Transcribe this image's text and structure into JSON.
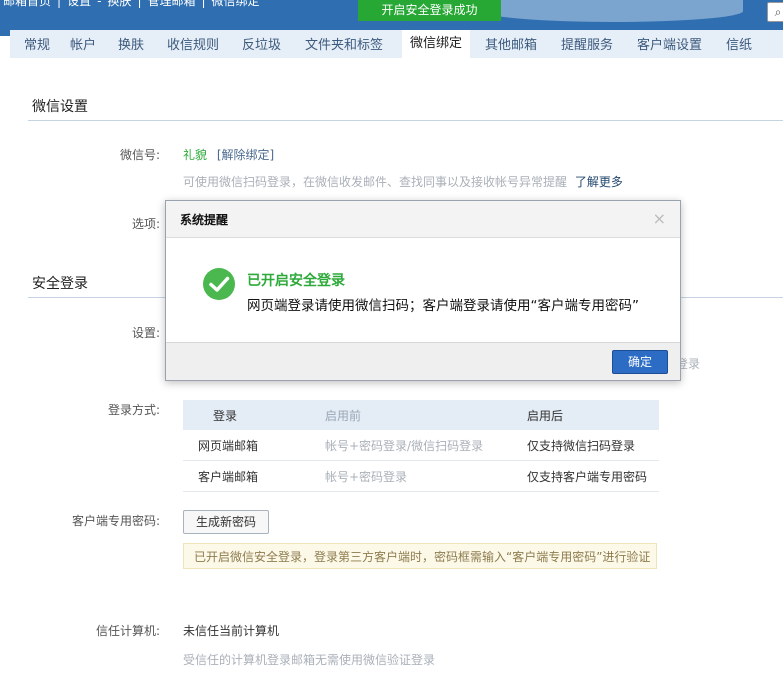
{
  "header": {
    "links": [
      "邮箱首页",
      "|",
      "设置",
      "-",
      "换肤",
      "|",
      "管理邮箱",
      "|",
      "微信绑定"
    ],
    "toast": "开启安全登录成功",
    "search_icon": "search-icon"
  },
  "tabs": [
    {
      "label": "常规"
    },
    {
      "label": "帐户"
    },
    {
      "label": "换肤"
    },
    {
      "label": "收信规则"
    },
    {
      "label": "反垃圾"
    },
    {
      "label": "文件夹和标签"
    },
    {
      "label": "微信绑定",
      "active": true
    },
    {
      "label": "其他邮箱"
    },
    {
      "label": "提醒服务"
    },
    {
      "label": "客户端设置"
    },
    {
      "label": "信纸"
    }
  ],
  "wechat": {
    "section_title": "微信设置",
    "account_label": "微信号:",
    "account_value": "礼貌",
    "unbind_link": "[解除绑定]",
    "hint": "可使用微信扫码登录，在微信收发邮件、查找同事以及接收帐号异常提醒",
    "learn_more": "了解更多",
    "options_label": "选项:"
  },
  "security": {
    "section_title": "安全登录",
    "settings_label": "设置:",
    "settings_suffix": "登录",
    "login_method_label": "登录方式:",
    "table": {
      "headers": [
        "登录",
        "启用前",
        "启用后"
      ],
      "rows": [
        [
          "网页端邮箱",
          "帐号+密码登录/微信扫码登录",
          "仅支持微信扫码登录"
        ],
        [
          "客户端邮箱",
          "帐号+密码登录",
          "仅支持客户端专用密码"
        ]
      ]
    },
    "client_pwd_label": "客户端专用密码:",
    "generate_button": "生成新密码",
    "notice": "已开启微信安全登录，登录第三方客户端时，密码框需输入“客户端专用密码”进行验证",
    "trusted_label": "信任计算机:",
    "trusted_value": "未信任当前计算机",
    "trusted_hint": "受信任的计算机登录邮箱无需使用微信验证登录"
  },
  "modal": {
    "title": "系统提醒",
    "close": "×",
    "message_title": "已开启安全登录",
    "message_body": "网页端登录请使用微信扫码；客户端登录请使用“客户端专用密码”",
    "ok_button": "确定"
  },
  "colors": {
    "header_bg": "#2f6fb1",
    "toast_green": "#27a834",
    "tab_bar_bg": "#e6eef7",
    "accent_green": "#2eaa3a",
    "ok_button": "#2c6cc4"
  }
}
